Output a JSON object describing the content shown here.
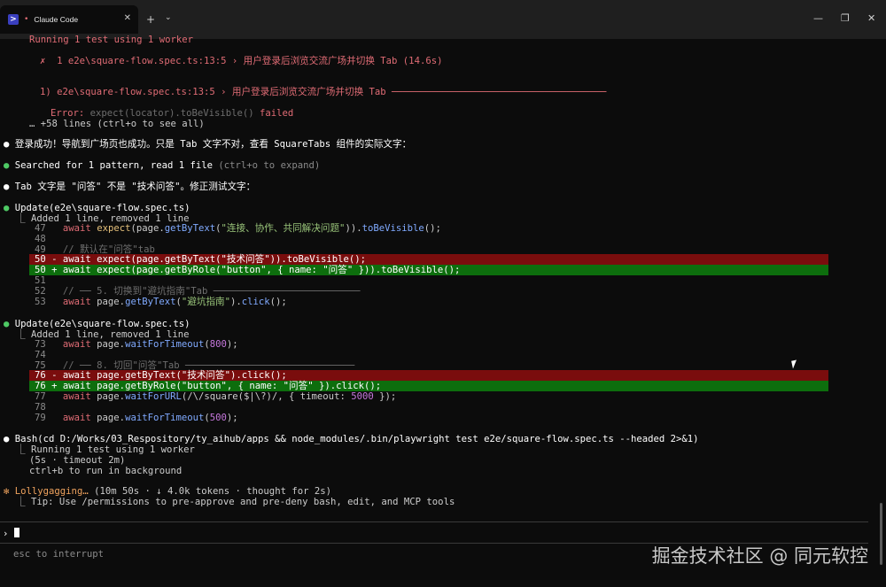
{
  "window": {
    "tab_title": "Claude Code",
    "tab_dot": "•",
    "close_tab": "✕",
    "new_tab": "+",
    "tab_dropdown": "⌄",
    "minimize": "—",
    "maximize": "❐",
    "close": "✕"
  },
  "test_output": {
    "running": "Running 1 test using 1 worker",
    "fail_line": "✗  1 e2e\\square-flow.spec.ts:13:5 › 用户登录后浏览交流广场并切换 Tab (14.6s)",
    "header": "1) e2e\\square-flow.spec.ts:13:5 › 用户登录后浏览交流广场并切换 Tab ──────────────────────────────────────",
    "error_label": "Error:",
    "error_detail": "expect(locator).toBeVisible()",
    "error_failed": "failed",
    "more_lines": "… +58 lines (ctrl+o to see all)"
  },
  "messages": {
    "m1": "登录成功！导航到广场页也成功。只是 Tab 文字不对，查看 SquareTabs 组件的实际文字：",
    "m2_main": "Searched for 1 pattern, read 1 file",
    "m2_hint": "(ctrl+o to expand)",
    "m3": "Tab 文字是 \"问答\" 不是 \"技术问答\"。修正测试文字："
  },
  "update1": {
    "title": "Update(e2e\\square-flow.spec.ts)",
    "summary": "⎿ Added 1 line, removed 1 line",
    "lines": [
      {
        "num": "47",
        "mark": " ",
        "code": "await expect(page.getByText(\"连接、协作、共同解决问题\")).toBeVisible();",
        "type": "ctx"
      },
      {
        "num": "48",
        "mark": " ",
        "code": "",
        "type": "ctx"
      },
      {
        "num": "49",
        "mark": " ",
        "code": "// 默认在\"问答\"tab",
        "type": "comment"
      },
      {
        "num": "50",
        "mark": "-",
        "code": "await expect(page.getByText(\"技术问答\")).toBeVisible();",
        "type": "del"
      },
      {
        "num": "50",
        "mark": "+",
        "code": "await expect(page.getByRole(\"button\", { name: \"问答\" })).toBeVisible();",
        "type": "add"
      },
      {
        "num": "51",
        "mark": " ",
        "code": "",
        "type": "ctx"
      },
      {
        "num": "52",
        "mark": " ",
        "code": "// ── 5. 切换到\"避坑指南\"Tab ──────────────────────────",
        "type": "comment"
      },
      {
        "num": "53",
        "mark": " ",
        "code": "await page.getByText(\"避坑指南\").click();",
        "type": "ctx"
      }
    ]
  },
  "update2": {
    "title": "Update(e2e\\square-flow.spec.ts)",
    "summary": "⎿ Added 1 line, removed 1 line",
    "lines": [
      {
        "num": "73",
        "mark": " ",
        "code": "await page.waitForTimeout(800);",
        "type": "ctx"
      },
      {
        "num": "74",
        "mark": " ",
        "code": "",
        "type": "ctx"
      },
      {
        "num": "75",
        "mark": " ",
        "code": "// ── 8. 切回\"问答\"Tab ──────────────────────────────",
        "type": "comment"
      },
      {
        "num": "76",
        "mark": "-",
        "code": "await page.getByText(\"技术问答\").click();",
        "type": "del"
      },
      {
        "num": "76",
        "mark": "+",
        "code": "await page.getByRole(\"button\", { name: \"问答\" }).click();",
        "type": "add"
      },
      {
        "num": "77",
        "mark": " ",
        "code": "await page.waitForURL(/\\/square($|\\?)/, { timeout: 5000 });",
        "type": "ctx"
      },
      {
        "num": "78",
        "mark": " ",
        "code": "",
        "type": "ctx"
      },
      {
        "num": "79",
        "mark": " ",
        "code": "await page.waitForTimeout(500);",
        "type": "ctx"
      }
    ]
  },
  "bash": {
    "title": "Bash(cd D:/Works/03_Respository/ty_aihub/apps && node_modules/.bin/playwright test e2e/square-flow.spec.ts --headed 2>&1)",
    "l1": "⎿ Running 1 test using 1 worker",
    "l2": "(5s · timeout 2m)",
    "l3": "ctrl+b to run in background"
  },
  "status": {
    "spinner": "✻",
    "label": "Lollygagging…",
    "detail": "(10m 50s · ↓ 4.0k tokens · thought for 2s)",
    "tip": "⎿ Tip: Use /permissions to pre-approve and pre-deny bash, edit, and MCP tools"
  },
  "prompt": {
    "symbol": "›",
    "footer": "esc to interrupt"
  },
  "watermark": "掘金技术社区 @ 同元软控"
}
